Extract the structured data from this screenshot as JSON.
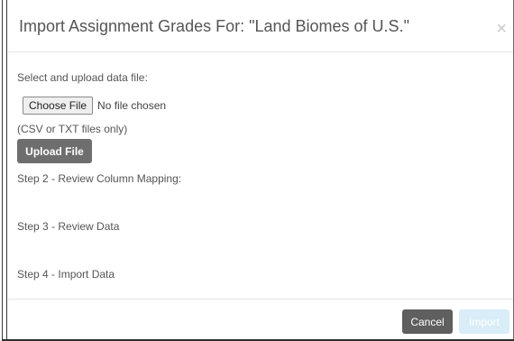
{
  "dialog": {
    "title": "Import Assignment Grades For: \"Land Biomes of U.S.\"",
    "close_symbol": "×"
  },
  "upload": {
    "prompt": "Select and upload data file:",
    "choose_file_label": "Choose File",
    "no_file_text": "No file chosen",
    "file_hint": "(CSV or TXT files only)",
    "upload_button_label": "Upload File"
  },
  "steps": {
    "step2": "Step 2 - Review Column Mapping:",
    "step3": "Step 3 - Review Data",
    "step4": "Step 4 - Import Data"
  },
  "footer": {
    "cancel_label": "Cancel",
    "import_label": "Import"
  },
  "colors": {
    "cancel_bg": "#5f5f5f",
    "upload_bg": "#6e6e6e",
    "import_disabled_bg": "#d8edf7"
  },
  "icons": {
    "close": "close-icon"
  }
}
